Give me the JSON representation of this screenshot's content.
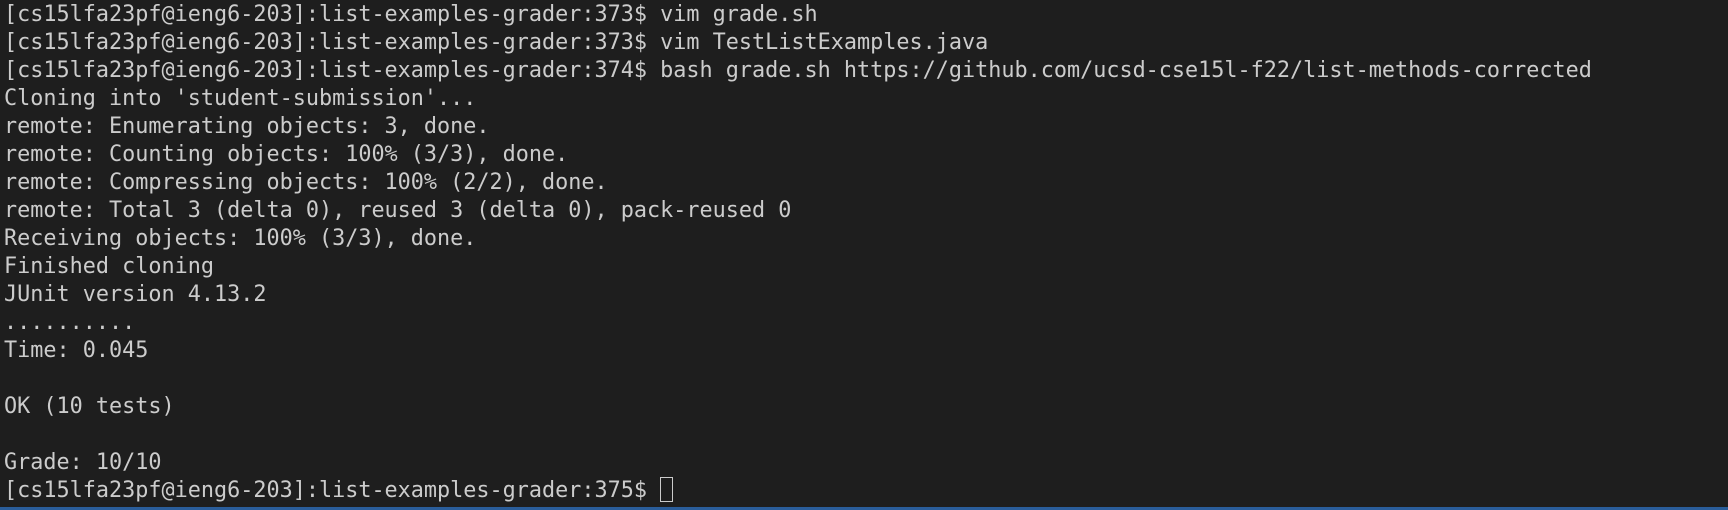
{
  "terminal": {
    "lines": [
      "[cs15lfa23pf@ieng6-203]:list-examples-grader:373$ vim grade.sh",
      "[cs15lfa23pf@ieng6-203]:list-examples-grader:373$ vim TestListExamples.java",
      "[cs15lfa23pf@ieng6-203]:list-examples-grader:374$ bash grade.sh https://github.com/ucsd-cse15l-f22/list-methods-corrected",
      "Cloning into 'student-submission'...",
      "remote: Enumerating objects: 3, done.",
      "remote: Counting objects: 100% (3/3), done.",
      "remote: Compressing objects: 100% (2/2), done.",
      "remote: Total 3 (delta 0), reused 3 (delta 0), pack-reused 0",
      "Receiving objects: 100% (3/3), done.",
      "Finished cloning",
      "JUnit version 4.13.2",
      "..........",
      "Time: 0.045",
      "",
      "OK (10 tests)",
      "",
      "Grade: 10/10"
    ],
    "prompt": "[cs15lfa23pf@ieng6-203]:list-examples-grader:375$ "
  },
  "colors": {
    "background": "#1e1e1e",
    "foreground": "#cccccc",
    "focus_edge": "#2a5d9a"
  }
}
